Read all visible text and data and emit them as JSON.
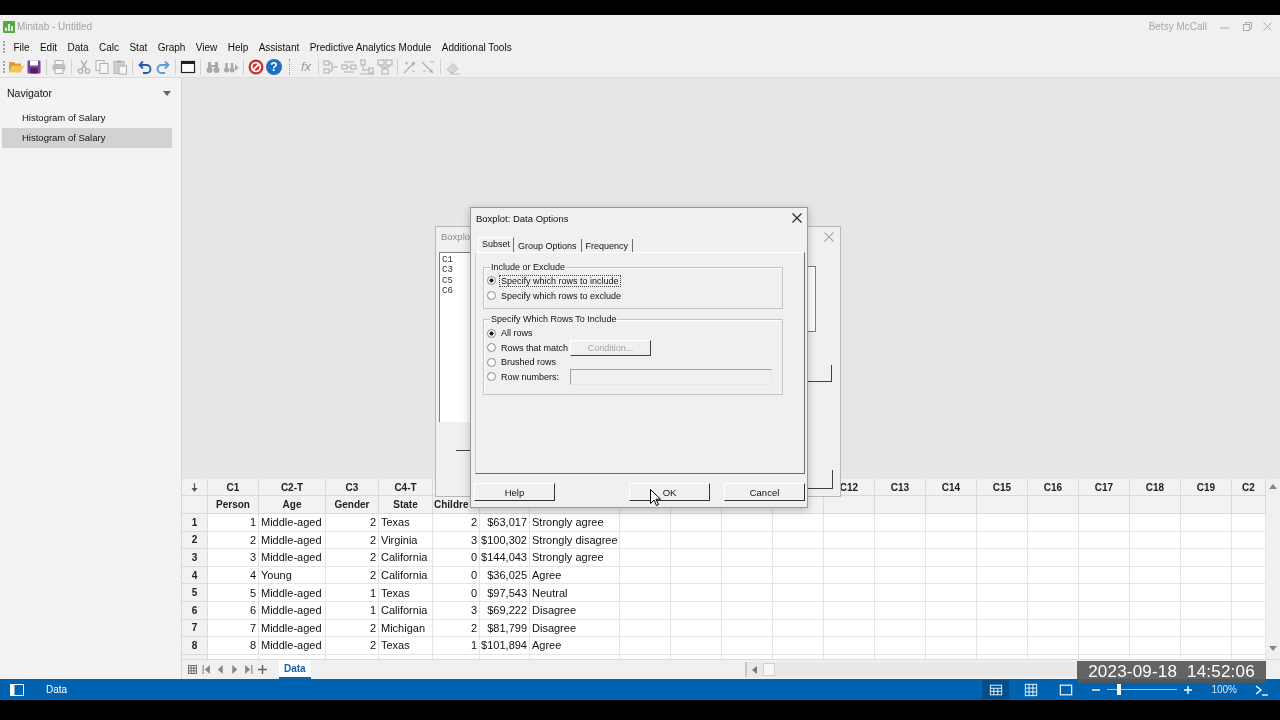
{
  "window": {
    "title": "Minitab - Untitled",
    "user": "Betsy McCall"
  },
  "menu": [
    "File",
    "Edit",
    "Data",
    "Calc",
    "Stat",
    "Graph",
    "View",
    "Help",
    "Assistant",
    "Predictive Analytics Module",
    "Additional Tools"
  ],
  "toolbar": [
    {
      "disabled": false
    },
    {
      "disabled": false
    },
    {
      "disabled": true
    },
    {
      "disabled": true
    },
    {
      "disabled": true
    },
    {
      "disabled": true
    },
    {
      "disabled": false
    },
    {
      "disabled": false
    },
    {
      "disabled": false
    },
    {
      "disabled": true
    },
    {
      "disabled": true
    },
    {
      "disabled": false
    },
    {
      "label": "?",
      "disabled": false
    },
    {
      "label": "fx",
      "disabled": true
    },
    {
      "disabled": true
    },
    {
      "disabled": true
    },
    {
      "disabled": true
    },
    {
      "disabled": true
    },
    {
      "disabled": true
    },
    {
      "disabled": true
    },
    {
      "disabled": true
    }
  ],
  "navigator": {
    "title": "Navigator",
    "items": [
      {
        "label": "Histogram of Salary",
        "selected": false
      },
      {
        "label": "Histogram of Salary",
        "selected": true
      }
    ]
  },
  "background_dialog": {
    "title": "Boxplo",
    "variables": [
      "C1",
      "C3",
      "C5",
      "C6"
    ]
  },
  "dialog": {
    "title": "Boxplot: Data Options",
    "tabs": [
      {
        "label": "Subset",
        "selected": true
      },
      {
        "label": "Group Options",
        "selected": false
      },
      {
        "label": "Frequency",
        "selected": false
      }
    ],
    "include_group": {
      "title": "Include or Exclude",
      "options": [
        {
          "label": "Specify which rows to include",
          "selected": true,
          "focused": true
        },
        {
          "label": "Specify which rows to exclude",
          "selected": false,
          "focused": false
        }
      ]
    },
    "rows_group": {
      "title": "Specify Which Rows To Include",
      "options": [
        {
          "label": "All rows",
          "selected": true,
          "kind": "plain"
        },
        {
          "label": "Rows that match",
          "selected": false,
          "kind": "button",
          "button": {
            "label": "Condition...",
            "disabled": true
          }
        },
        {
          "label": "Brushed rows",
          "selected": false,
          "kind": "plain"
        },
        {
          "label": "Row numbers:",
          "selected": false,
          "kind": "field",
          "field": {
            "disabled": true
          }
        }
      ]
    },
    "buttons": [
      {
        "label": "Help"
      },
      {
        "label": "OK"
      },
      {
        "label": "Cancel"
      }
    ]
  },
  "worksheet": {
    "columns": [
      {
        "id": "C1",
        "name": "Person",
        "kind": "number"
      },
      {
        "id": "C2-T",
        "name": "Age",
        "kind": "text"
      },
      {
        "id": "C3",
        "name": "Gender",
        "kind": "number"
      },
      {
        "id": "C4-T",
        "name": "State",
        "kind": "text"
      },
      {
        "name": "Childre",
        "kind": "number"
      },
      {
        "kind": "number"
      },
      {
        "kind": "text"
      }
    ],
    "more_columns": [
      "C12",
      "C13",
      "C14",
      "C15",
      "C16",
      "C17",
      "C18",
      "C19",
      "C2"
    ],
    "rows": [
      {
        "n": "1",
        "cells": [
          "1",
          "Middle-aged",
          "2",
          "Texas",
          "2",
          "$63,017",
          "Strongly agree"
        ]
      },
      {
        "n": "2",
        "cells": [
          "2",
          "Middle-aged",
          "2",
          "Virginia",
          "3",
          "$100,302",
          "Strongly disagree"
        ]
      },
      {
        "n": "3",
        "cells": [
          "3",
          "Middle-aged",
          "2",
          "California",
          "0",
          "$144,043",
          "Strongly agree"
        ]
      },
      {
        "n": "4",
        "cells": [
          "4",
          "Young",
          "2",
          "California",
          "0",
          "$36,025",
          "Agree"
        ]
      },
      {
        "n": "5",
        "cells": [
          "5",
          "Middle-aged",
          "1",
          "Texas",
          "0",
          "$97,543",
          "Neutral"
        ]
      },
      {
        "n": "6",
        "cells": [
          "6",
          "Middle-aged",
          "1",
          "California",
          "3",
          "$69,222",
          "Disagree"
        ]
      },
      {
        "n": "7",
        "cells": [
          "7",
          "Middle-aged",
          "2",
          "Michigan",
          "2",
          "$81,799",
          "Disagree"
        ]
      },
      {
        "n": "8",
        "cells": [
          "8",
          "Middle-aged",
          "2",
          "Texas",
          "1",
          "$101,894",
          "Agree"
        ]
      }
    ]
  },
  "sheet_tabs": [
    {
      "label": "Data",
      "selected": true
    }
  ],
  "status_bar": {
    "label": "Data",
    "views": [
      {
        "selected": true
      },
      {
        "selected": false
      },
      {
        "selected": false
      }
    ],
    "zoom": {
      "level": 0.14,
      "reading": "100%"
    }
  },
  "recording_timestamp": "2023-09-18  14:52:06"
}
